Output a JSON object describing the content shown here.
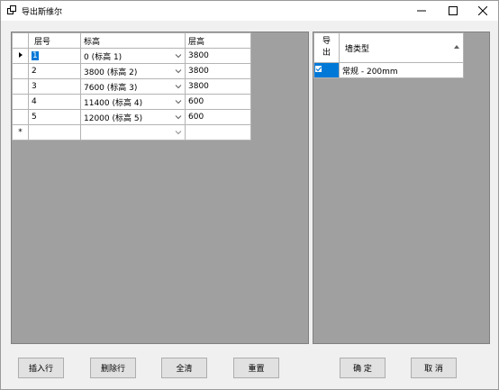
{
  "window": {
    "title": "导出斯维尔"
  },
  "left_grid": {
    "columns": [
      "层号",
      "标高",
      "层高"
    ],
    "rows": [
      {
        "floor": "1",
        "elevation": "0 (标高 1)",
        "height": "3800"
      },
      {
        "floor": "2",
        "elevation": "3800 (标高 2)",
        "height": "3800"
      },
      {
        "floor": "3",
        "elevation": "7600 (标高 3)",
        "height": "3800"
      },
      {
        "floor": "4",
        "elevation": "11400 (标高 4)",
        "height": "600"
      },
      {
        "floor": "5",
        "elevation": "12000 (标高 5)",
        "height": "600"
      }
    ],
    "new_row_marker": "*"
  },
  "right_grid": {
    "columns": [
      "导出",
      "墙类型"
    ],
    "rows": [
      {
        "checked": true,
        "wall_type": "常规 - 200mm"
      }
    ]
  },
  "buttons": {
    "insert_row": "插入行",
    "delete_row": "删除行",
    "clear_all": "全清",
    "reset": "重置",
    "ok": "确 定",
    "cancel": "取 消"
  },
  "icons": {
    "app": "export-icon",
    "minimize": "minimize-icon",
    "maximize": "maximize-icon",
    "close": "close-icon",
    "row_current": "row-indicator-arrow-icon",
    "dropdown": "chevron-down-icon",
    "sort": "sort-ascending-icon",
    "check": "checkmark-icon"
  },
  "colors": {
    "selection": "#0078d7",
    "grid_background": "#a0a0a0"
  }
}
